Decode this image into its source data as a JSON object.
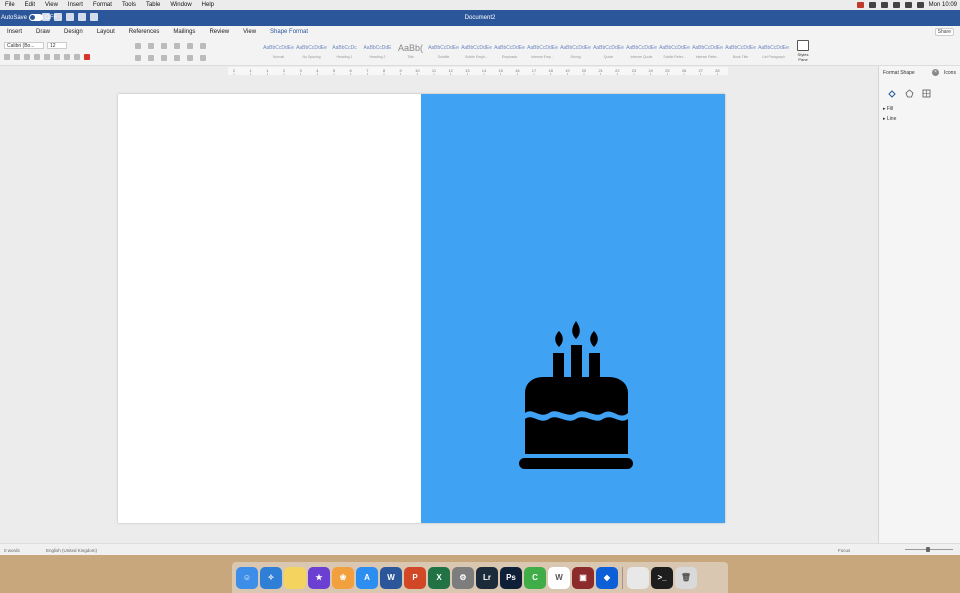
{
  "menubar": {
    "items": [
      "File",
      "Edit",
      "View",
      "Insert",
      "Format",
      "Tools",
      "Table",
      "Window",
      "Help"
    ],
    "clock": "Mon 10:09"
  },
  "titlebar": {
    "autosave_label": "AutoSave",
    "autosave_state": "OFF",
    "document_title": "Document2"
  },
  "tabs": {
    "items": [
      "Insert",
      "Draw",
      "Design",
      "Layout",
      "References",
      "Mailings",
      "Review",
      "View",
      "Shape Format"
    ],
    "active": "Shape Format",
    "share_label": "Share"
  },
  "ribbon": {
    "font_name": "Calibri (Bo...",
    "font_size": "12",
    "styles": [
      {
        "preview": "AaBbCcDdEe",
        "name": "Normal"
      },
      {
        "preview": "AaBbCcDdEe",
        "name": "No Spacing"
      },
      {
        "preview": "AaBbCcDc",
        "name": "Heading 1"
      },
      {
        "preview": "AaBbCcDdE",
        "name": "Heading 2"
      },
      {
        "preview": "AaBb(",
        "name": "Title"
      },
      {
        "preview": "AaBbCcDdEe",
        "name": "Subtitle"
      },
      {
        "preview": "AaBbCcDdEe",
        "name": "Subtle Emph..."
      },
      {
        "preview": "AaBbCcDdEe",
        "name": "Emphasis"
      },
      {
        "preview": "AaBbCcDdEe",
        "name": "Intense Emp..."
      },
      {
        "preview": "AaBbCcDdEe",
        "name": "Strong"
      },
      {
        "preview": "AaBbCcDdEe",
        "name": "Quote"
      },
      {
        "preview": "AaBbCcDdEe",
        "name": "Intense Quote"
      },
      {
        "preview": "AaBbCcDdEe",
        "name": "Subtle Refer..."
      },
      {
        "preview": "AaBbCcDdEe",
        "name": "Intense Refer..."
      },
      {
        "preview": "AaBbCcDdEe",
        "name": "Book Title"
      },
      {
        "preview": "AaBbCcDdEe",
        "name": "List Paragraph"
      }
    ],
    "styles_pane_label": "Styles Pane"
  },
  "ruler": {
    "ticks": [
      "2",
      "1",
      "1",
      "2",
      "3",
      "4",
      "5",
      "6",
      "7",
      "8",
      "9",
      "10",
      "11",
      "12",
      "13",
      "14",
      "15",
      "16",
      "17",
      "18",
      "19",
      "20",
      "21",
      "22",
      "23",
      "24",
      "25",
      "26",
      "27",
      "28"
    ]
  },
  "document": {
    "shape_fill": "#40a2f3",
    "icon": "birthday-cake-icon"
  },
  "format_pane": {
    "title": "Format Shape",
    "icons_tab": "Icons",
    "sections": [
      "Fill",
      "Line"
    ]
  },
  "statusbar": {
    "word_count": "0 words",
    "language": "English (United Kingdom)",
    "focus_label": "Focus"
  },
  "dock": {
    "apps": [
      {
        "name": "Finder",
        "color": "#3d8ee8",
        "glyph": "☺"
      },
      {
        "name": "Safari",
        "color": "#2f7fd6",
        "glyph": "✧"
      },
      {
        "name": "Notes",
        "color": "#f4d35e",
        "glyph": ""
      },
      {
        "name": "iMovie",
        "color": "#6a3fd1",
        "glyph": "★"
      },
      {
        "name": "Photos",
        "color": "#f2a03d",
        "glyph": "❀"
      },
      {
        "name": "App Store",
        "color": "#2b8ef0",
        "glyph": "A"
      },
      {
        "name": "Word",
        "color": "#2b579a",
        "glyph": "W"
      },
      {
        "name": "PowerPoint",
        "color": "#d24726",
        "glyph": "P"
      },
      {
        "name": "Excel",
        "color": "#217346",
        "glyph": "X"
      },
      {
        "name": "System Preferences",
        "color": "#7d7d7d",
        "glyph": "⚙"
      },
      {
        "name": "Lightroom",
        "color": "#1c2b3a",
        "glyph": "Lr"
      },
      {
        "name": "Photoshop",
        "color": "#0f1f38",
        "glyph": "Ps"
      },
      {
        "name": "Camtasia",
        "color": "#3fae49",
        "glyph": "C"
      },
      {
        "name": "Wunderlist",
        "color": "#ffffff",
        "glyph": "W"
      },
      {
        "name": "Photo Booth",
        "color": "#8b2b2b",
        "glyph": "▣"
      },
      {
        "name": "Dropbox",
        "color": "#0d5fd8",
        "glyph": "◆"
      },
      {
        "name": "Downloads",
        "color": "#e8e8e8",
        "glyph": ""
      },
      {
        "name": "Terminal",
        "color": "#1d1d1d",
        "glyph": ">_"
      },
      {
        "name": "Trash",
        "color": "#d9d9d9",
        "glyph": "🗑"
      }
    ]
  }
}
